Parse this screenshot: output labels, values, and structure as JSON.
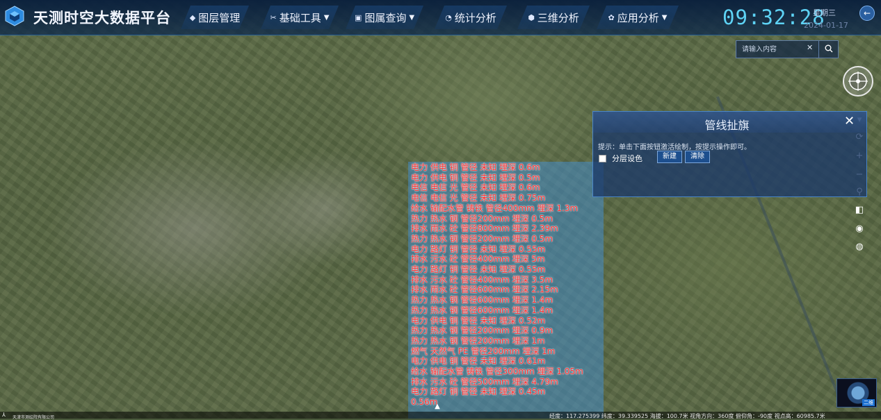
{
  "app": {
    "title": "天测时空大数据平台"
  },
  "nav": [
    {
      "label": "图层管理",
      "icon": "layers-icon",
      "dropdown": false
    },
    {
      "label": "基础工具",
      "icon": "tools-icon",
      "dropdown": true
    },
    {
      "label": "图属查询",
      "icon": "query-icon",
      "dropdown": true
    },
    {
      "label": "统计分析",
      "icon": "chart-icon",
      "dropdown": false
    },
    {
      "label": "三维分析",
      "icon": "cube-icon",
      "dropdown": false
    },
    {
      "label": "应用分析",
      "icon": "app-icon",
      "dropdown": true
    }
  ],
  "header": {
    "time": "09:32:28",
    "weekday": "星期三",
    "date": "2024-01-17"
  },
  "search": {
    "placeholder": "请输入内容",
    "clear_icon": "close-icon",
    "button_icon": "search-icon"
  },
  "panel": {
    "title": "管线扯旗",
    "hint": "提示：单击下面按钮激活绘制，按提示操作即可。",
    "layer_label": "分层设色",
    "new_button": "新建",
    "clear_button": "清除"
  },
  "pipes": [
    "电力  供电  铜  管径 未知  埋深 0.6m",
    "电力  供电  铜  管径 未知  埋深 0.5m",
    "电信  电信  光  管径 未知  埋深 0.6m",
    "电信  电信  光  管径 未知  埋深 0.75m",
    "给水  输配水管  铸铁  管径400mm  埋深 1.3m",
    "热力  热水  钢  管径200mm  埋深 0.5m",
    "排水  雨水  砼  管径800mm  埋深 2.39m",
    "热力  热水  钢  管径200mm  埋深 0.5m",
    "电力  路灯  铜  管径 未知  埋深 0.55m",
    "排水  污水  砼  管径400mm  埋深 5m",
    "电力  路灯  铜  管径 未知  埋深 0.55m",
    "排水  污水  砼  管径400mm  埋深 3.5m",
    "排水  雨水  砼  管径600mm  埋深 2.15m",
    "热力  热水  钢  管径600mm  埋深 1.4m",
    "热力  热水  钢  管径600mm  埋深 1.4m",
    "电力  供电  铜  管径 未知  埋深 0.52m",
    "热力  热水  钢  管径200mm  埋深 0.9m",
    "热力  热水  钢  管径200mm  埋深 1m",
    "燃气  天然气  PE  管径200mm  埋深 1m",
    "电力  供电  铜  管径 未知  埋深 0.61m",
    "给水  输配水管  铸铁  管径300mm  埋深 1.05m",
    "排水  污水  砼  管径500mm  埋深 4.79m",
    "电力  路灯  铜  管径 未知  埋深 0.45m",
    "0.56m"
  ],
  "footer": {
    "company": "天津市测绘院有限公司",
    "coords": "经度：117.275399    纬度：39.339525    海拔：100.7米    视角方向：360度    俯仰角：-90度    视点高：60985.7米"
  },
  "minimap": {
    "label": "二维"
  },
  "right_tools": [
    "locate-icon",
    "rotate-icon",
    "zoom-in-icon",
    "zoom-out-icon",
    "person-icon",
    "split-icon",
    "eye-icon",
    "globe-icon"
  ],
  "colors": {
    "clock": "#5ed3f5",
    "pipe_text": "#ff3030",
    "panel_border": "#4a86c9"
  }
}
